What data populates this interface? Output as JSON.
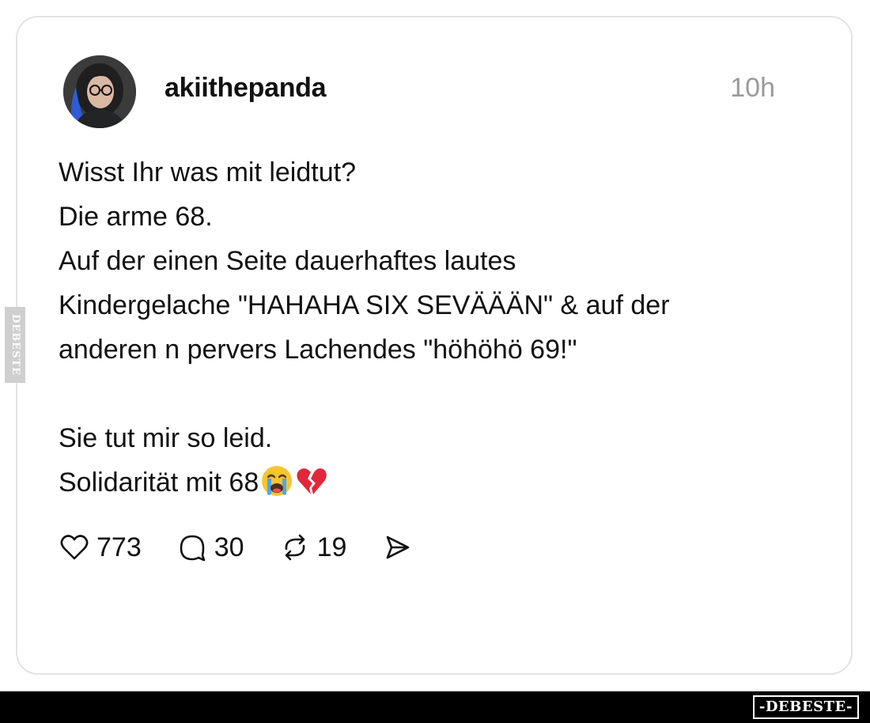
{
  "post": {
    "username": "akiithepanda",
    "time": "10h",
    "lines": [
      "Wisst Ihr was mit leidtut?",
      "Die arme 68.",
      "Auf der einen Seite dauerhaftes lautes",
      "Kindergelache \"HAHAHA SIX SEVÄÄÄN\" & auf der",
      "anderen n pervers Lachendes \"höhöhö 69!\"",
      "",
      "Sie tut mir so leid.",
      "Solidarität mit 68"
    ],
    "emojis": [
      "crying-face",
      "broken-heart"
    ]
  },
  "actions": {
    "likes": "773",
    "comments": "30",
    "reposts": "19"
  },
  "watermark": {
    "side_text": "DEBESTE",
    "footer_text": "-DEBESTE-"
  },
  "colors": {
    "text": "#111111",
    "muted": "#9a9a9a",
    "card_border": "#e3e3e3",
    "footer_bg": "#000000"
  }
}
